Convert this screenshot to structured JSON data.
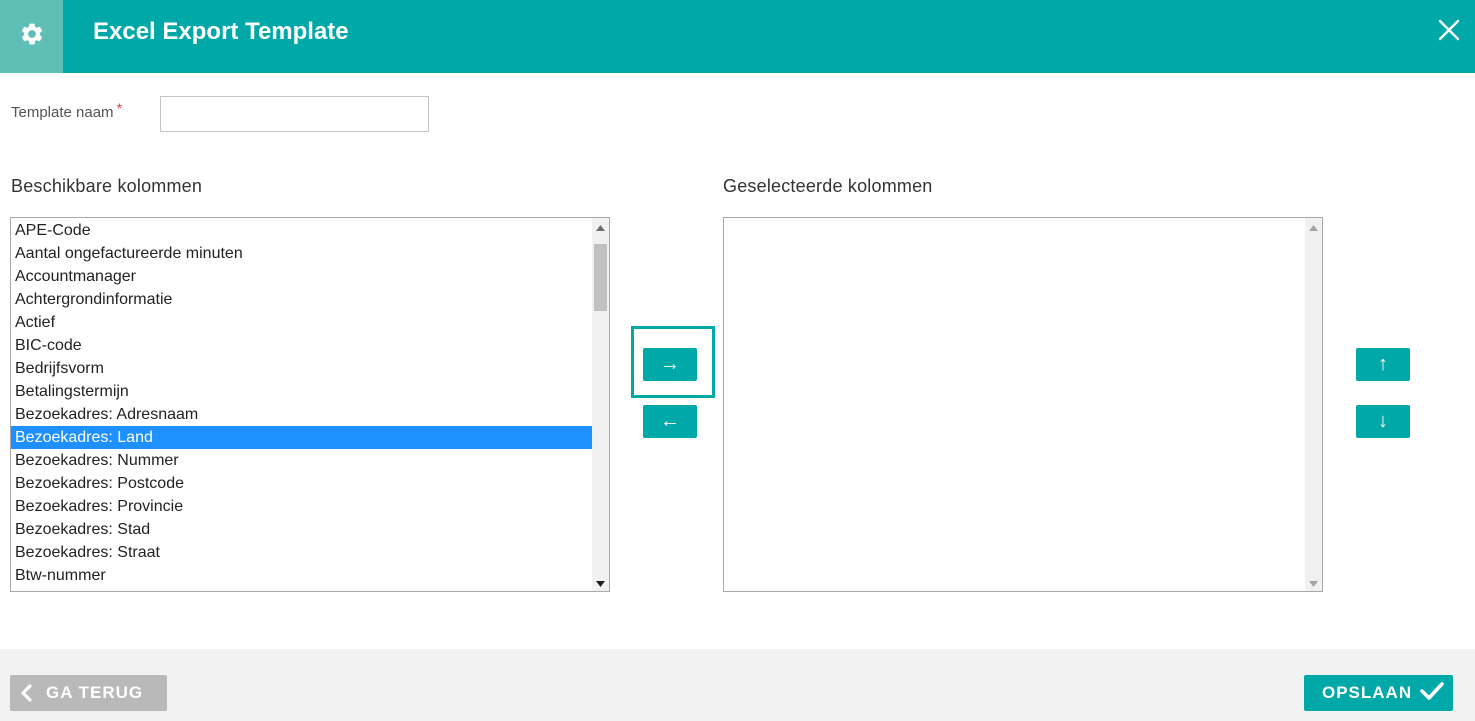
{
  "header": {
    "title": "Excel Export Template",
    "accent_color": "#00a8a8",
    "gear_icon": "gear-icon",
    "close_icon": "close-icon"
  },
  "form": {
    "name_label": "Template naam",
    "required_marker": "*",
    "name_value": "",
    "name_placeholder": ""
  },
  "available": {
    "heading": "Beschikbare kolommen",
    "selected_index": 9,
    "items": [
      "APE-Code",
      "Aantal ongefactureerde minuten",
      "Accountmanager",
      "Achtergrondinformatie",
      "Actief",
      "BIC-code",
      "Bedrijfsvorm",
      "Betalingstermijn",
      "Bezoekadres: Adresnaam",
      "Bezoekadres: Land",
      "Bezoekadres: Nummer",
      "Bezoekadres: Postcode",
      "Bezoekadres: Provincie",
      "Bezoekadres: Stad",
      "Bezoekadres: Straat",
      "Btw-nummer"
    ]
  },
  "selected": {
    "heading": "Geselecteerde kolommen",
    "items": []
  },
  "transfer": {
    "add_label": "→",
    "remove_label": "←",
    "up_label": "↑",
    "down_label": "↓"
  },
  "footer": {
    "back_label": "GA TERUG",
    "save_label": "OPSLAAN",
    "back_icon": "chevron-left-icon",
    "save_icon": "check-icon"
  }
}
